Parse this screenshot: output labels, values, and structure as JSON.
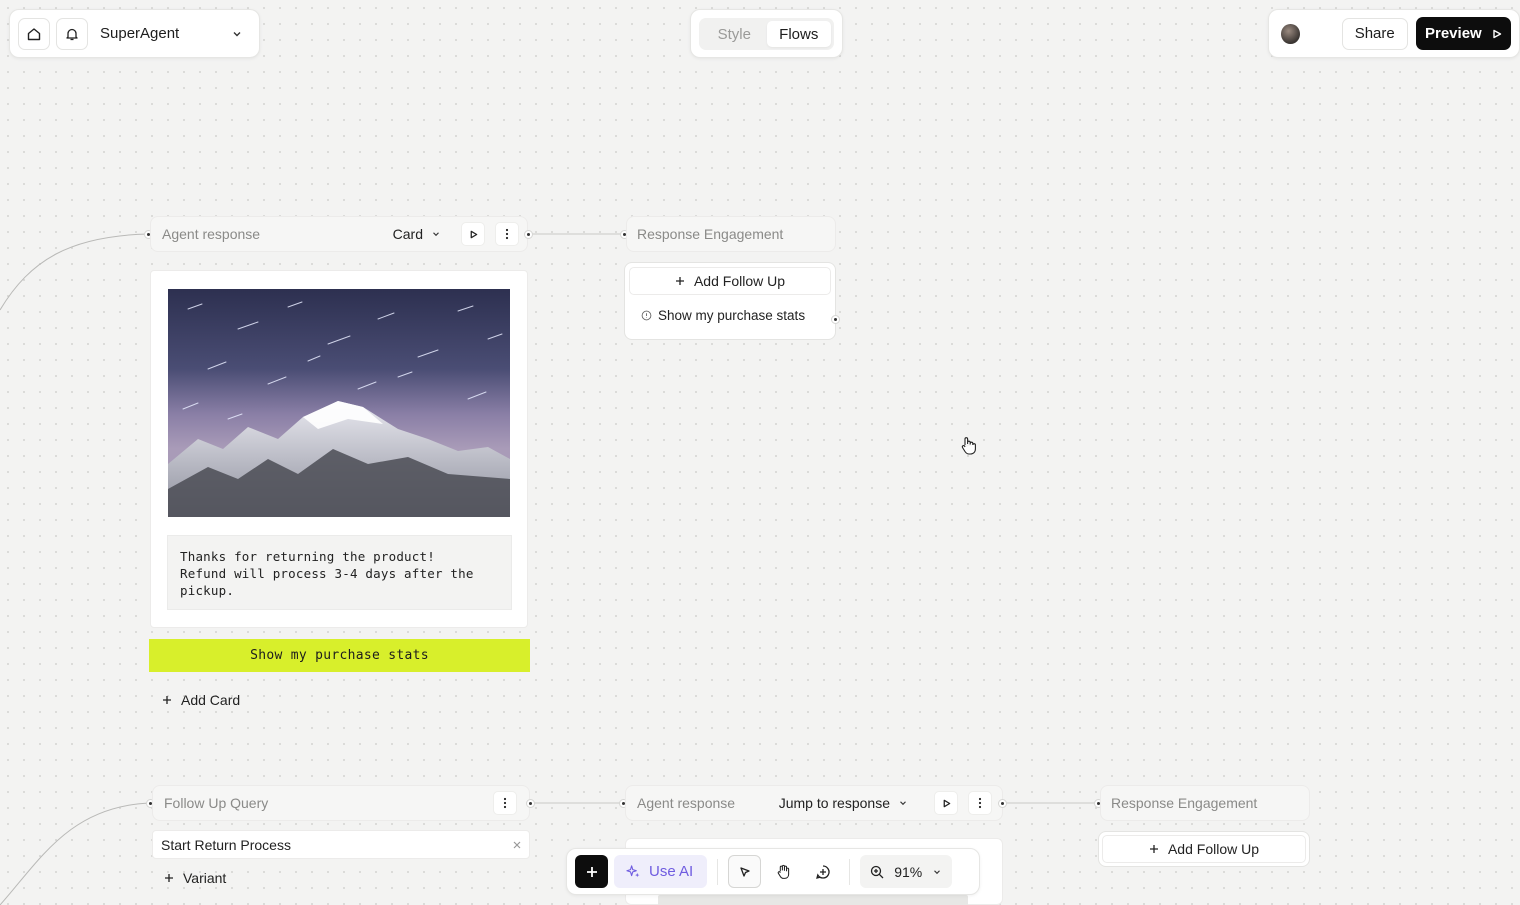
{
  "topbar": {
    "project_name": "SuperAgent",
    "tabs": [
      {
        "label": "Style",
        "active": false
      },
      {
        "label": "Flows",
        "active": true
      }
    ],
    "share_label": "Share",
    "preview_label": "Preview"
  },
  "nodes": {
    "agent_response_1": {
      "title": "Agent response",
      "type_label": "Card",
      "message": "Thanks for returning the product!\nRefund will process 3-4 days after the pickup.",
      "button_label": "Show my purchase stats",
      "add_card_label": "Add Card"
    },
    "engagement_1": {
      "title": "Response Engagement",
      "add_follow_up_label": "Add Follow Up",
      "follow_up_item": "Show my purchase stats"
    },
    "follow_up_query": {
      "title": "Follow Up Query",
      "query_value": "Start Return Process",
      "variant_label": "Variant"
    },
    "agent_response_2": {
      "title": "Agent response",
      "type_label": "Jump to response"
    },
    "engagement_2": {
      "title": "Response Engagement",
      "add_follow_up_label": "Add Follow Up"
    }
  },
  "toolbar": {
    "use_ai_label": "Use AI",
    "zoom_label": "91%"
  },
  "colors": {
    "accent_lime": "#d8ef2b",
    "ai_purple": "#6f5ce0",
    "background": "#f3f3f2"
  }
}
